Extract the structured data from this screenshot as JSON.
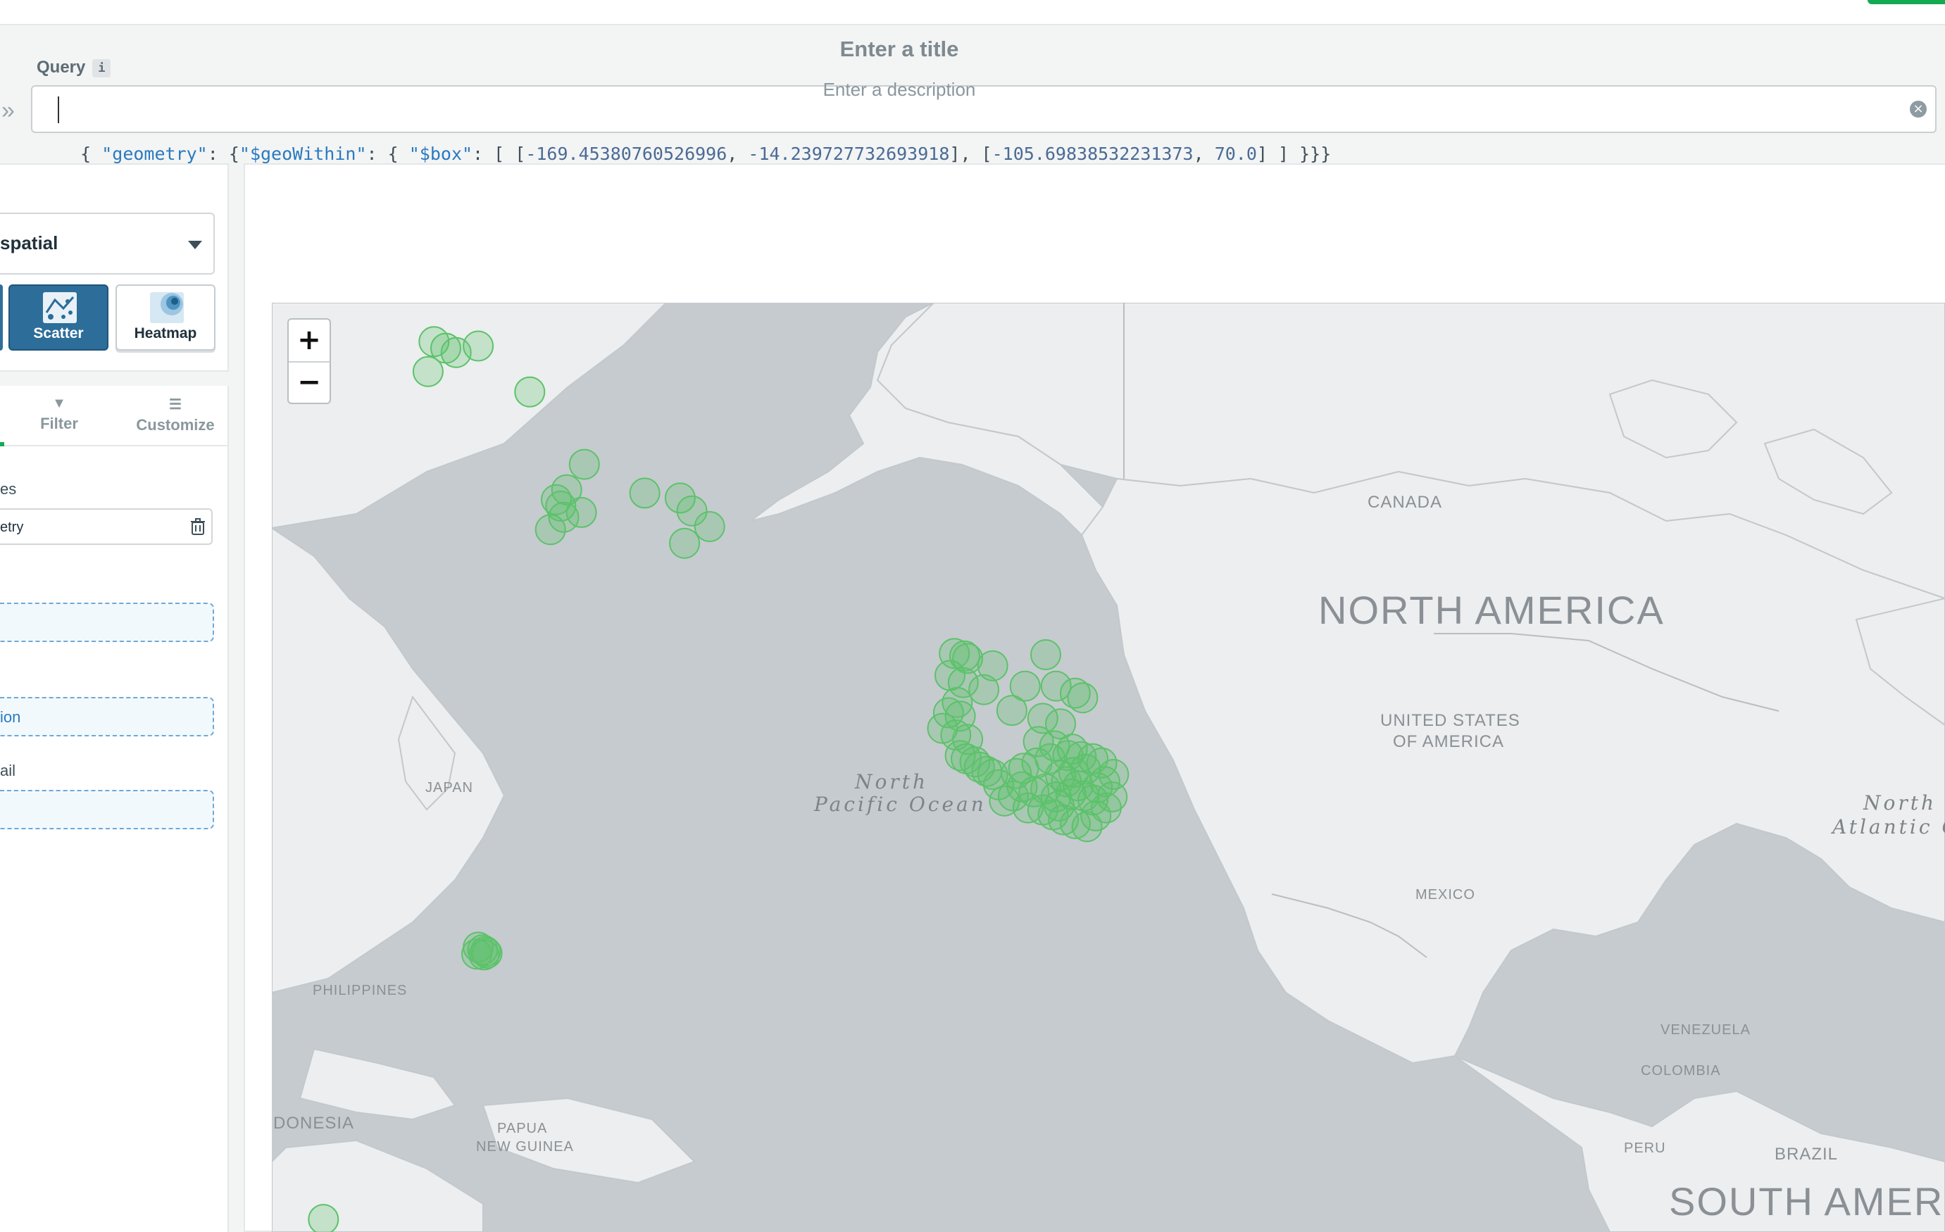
{
  "query": {
    "label": "Query",
    "info_badge": "i",
    "expand_glyph": "»",
    "text_parts": {
      "open": "{ ",
      "k_geometry": "\"geometry\"",
      "colon1": ": {",
      "k_geowithin": "\"$geoWithin\"",
      "colon2": ": { ",
      "k_box": "\"$box\"",
      "colon3": ": [ [",
      "n1": "-169.45380760526996",
      "sep1": ", ",
      "n2": "-14.239727732693918",
      "mid": "], [",
      "n3": "-105.69838532231373",
      "sep2": ", ",
      "n4": "70.0",
      "close": "] ] }}}"
    },
    "clear_icon": "clear-icon"
  },
  "chart_builder": {
    "chart_type_label": "spatial",
    "tiles": [
      {
        "label": "Scatter",
        "selected": true,
        "icon": "scatter-map-icon"
      },
      {
        "label": "Heatmap",
        "selected": false,
        "icon": "heatmap-icon"
      }
    ],
    "tabs": [
      {
        "label": "Filter",
        "icon": "filter-icon"
      },
      {
        "label": "Customize",
        "icon": "sliders-icon"
      }
    ],
    "sections": [
      {
        "label": "es"
      },
      {
        "label": "ail"
      }
    ],
    "coordinates_field": "etry",
    "drop_zones": [
      {
        "label": ""
      },
      {
        "label": "ion"
      },
      {
        "label": ""
      }
    ]
  },
  "chart": {
    "title": "Enter a title",
    "description": "Enter a description",
    "zoom_in": "+",
    "zoom_out": "−",
    "marker_color": "#5cc26a",
    "map_labels": {
      "canada": "CANADA",
      "north_america": "NORTH AMERICA",
      "usa_line1": "UNITED STATES",
      "usa_line2": "OF AMERICA",
      "mexico": "MEXICO",
      "japan": "JAPAN",
      "philippines": "PHILIPPINES",
      "indonesia": "DONESIA",
      "png_line1": "PAPUA",
      "png_line2": "NEW GUINEA",
      "venezuela": "VENEZUELA",
      "colombia": "COLOMBIA",
      "peru": "PERU",
      "brazil": "BRAZIL",
      "south_america": "SOUTH AMERICA",
      "pacific_line1": "North",
      "pacific_line2": "Pacific Ocean",
      "atlantic_line1": "North",
      "atlantic_line2": "Atlantic O"
    }
  },
  "chart_data": {
    "type": "scatter",
    "title": "",
    "xlabel": "",
    "ylabel": "",
    "x_axis": "longitude",
    "y_axis": "latitude",
    "xlim": [
      -169.45,
      -105.7
    ],
    "ylim": [
      -14.24,
      70.0
    ],
    "points": [
      [
        -158.5,
        68.3
      ],
      [
        -157.7,
        68.0
      ],
      [
        -157.0,
        67.8
      ],
      [
        -155.5,
        68.1
      ],
      [
        -158.9,
        66.9
      ],
      [
        -152.0,
        65.9
      ],
      [
        -148.3,
        62.0
      ],
      [
        -149.5,
        60.5
      ],
      [
        -150.2,
        59.9
      ],
      [
        -149.9,
        59.5
      ],
      [
        -149.7,
        58.8
      ],
      [
        -150.6,
        58.0
      ],
      [
        -148.5,
        59.1
      ],
      [
        -144.2,
        60.3
      ],
      [
        -141.8,
        60.0
      ],
      [
        -141.0,
        59.2
      ],
      [
        -139.8,
        58.2
      ],
      [
        -141.5,
        57.1
      ],
      [
        -123.2,
        49.0
      ],
      [
        -122.5,
        48.8
      ],
      [
        -122.3,
        48.6
      ],
      [
        -120.6,
        48.0
      ],
      [
        -117.0,
        48.9
      ],
      [
        -123.5,
        47.2
      ],
      [
        -122.6,
        46.6
      ],
      [
        -121.2,
        46.0
      ],
      [
        -118.4,
        46.3
      ],
      [
        -116.3,
        46.3
      ],
      [
        -115.0,
        45.7
      ],
      [
        -114.5,
        45.3
      ],
      [
        -123.0,
        44.9
      ],
      [
        -123.6,
        44.0
      ],
      [
        -122.8,
        43.7
      ],
      [
        -119.3,
        44.2
      ],
      [
        -117.2,
        43.5
      ],
      [
        -116.0,
        43.0
      ],
      [
        -124.0,
        42.6
      ],
      [
        -123.1,
        42.0
      ],
      [
        -122.3,
        41.6
      ],
      [
        -117.5,
        41.4
      ],
      [
        -116.4,
        41.0
      ],
      [
        -115.2,
        40.7
      ],
      [
        -122.8,
        40.1
      ],
      [
        -122.4,
        39.8
      ],
      [
        -121.8,
        39.5
      ],
      [
        -121.5,
        39.0
      ],
      [
        -121.0,
        38.6
      ],
      [
        -120.6,
        38.3
      ],
      [
        -116.7,
        39.8
      ],
      [
        -115.5,
        40.1
      ],
      [
        -114.6,
        40.0
      ],
      [
        -113.8,
        39.8
      ],
      [
        -113.2,
        39.4
      ],
      [
        -114.3,
        38.8
      ],
      [
        -115.1,
        38.5
      ],
      [
        -116.0,
        38.2
      ],
      [
        -115.6,
        37.6
      ],
      [
        -114.8,
        37.2
      ],
      [
        -113.5,
        37.0
      ],
      [
        -115.3,
        36.4
      ],
      [
        -114.4,
        36.2
      ],
      [
        -113.8,
        35.8
      ],
      [
        -116.3,
        36.1
      ],
      [
        -117.8,
        36.6
      ],
      [
        -118.6,
        37.1
      ],
      [
        -119.2,
        36.2
      ],
      [
        -119.8,
        35.7
      ],
      [
        -118.2,
        35.0
      ],
      [
        -117.2,
        34.8
      ],
      [
        -116.5,
        34.3
      ],
      [
        -115.8,
        33.8
      ],
      [
        -115.0,
        33.4
      ],
      [
        -114.2,
        33.1
      ],
      [
        -113.6,
        34.2
      ],
      [
        -112.9,
        35.0
      ],
      [
        -112.5,
        36.1
      ],
      [
        -113.0,
        37.6
      ],
      [
        -112.4,
        38.3
      ],
      [
        -120.2,
        37.3
      ],
      [
        -119.0,
        38.4
      ],
      [
        -118.5,
        38.9
      ],
      [
        -117.6,
        39.4
      ],
      [
        -117.0,
        36.9
      ],
      [
        -116.1,
        35.2
      ],
      [
        -155.5,
        19.9
      ],
      [
        -155.2,
        19.6
      ],
      [
        -155.0,
        19.4
      ],
      [
        -154.9,
        19.2
      ],
      [
        -155.6,
        19.1
      ],
      [
        -155.1,
        19.0
      ],
      [
        -166.0,
        -13.0
      ]
    ]
  }
}
